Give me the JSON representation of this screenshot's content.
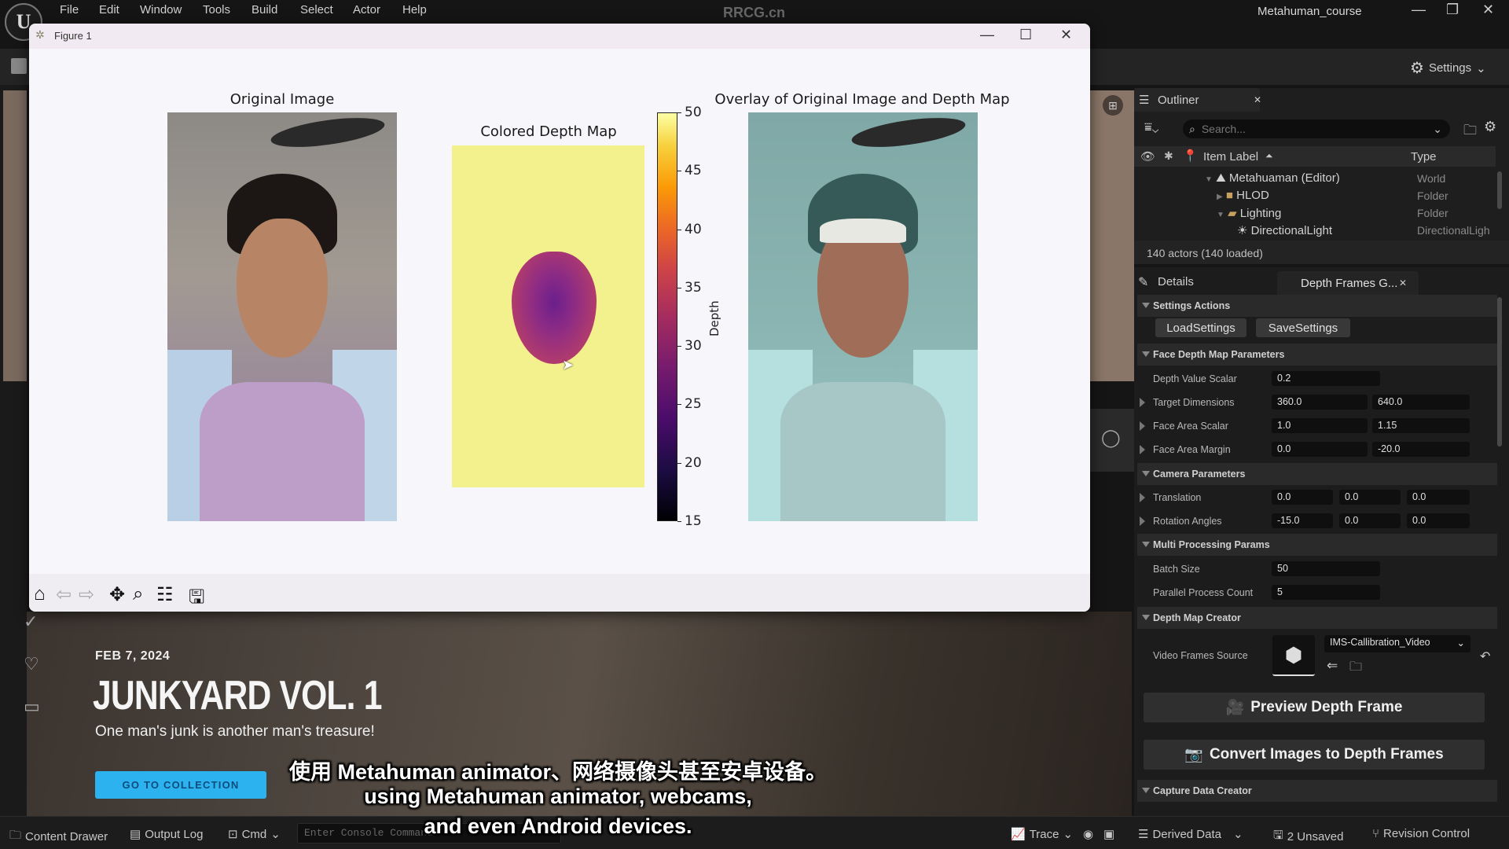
{
  "app": {
    "logo": "U",
    "menu": [
      "File",
      "Edit",
      "Window",
      "Tools",
      "Build",
      "Select",
      "Actor",
      "Help"
    ],
    "watermark": "RRCG.cn",
    "project_title": "Metahuman_course",
    "window_controls": {
      "minimize": "—",
      "restore": "❐",
      "close": "✕"
    },
    "settings_label": "Settings"
  },
  "figure": {
    "title": "Figure 1",
    "controls": {
      "minimize": "—",
      "maximize": "☐",
      "close": "✕"
    },
    "panels": {
      "original_title": "Original Image",
      "depth_title": "Colored Depth Map",
      "overlay_title": "Overlay of Original Image and Depth Map"
    },
    "toolbar": [
      "home-icon",
      "back-icon",
      "forward-icon",
      "pan-icon",
      "zoom-icon",
      "configure-icon",
      "save-icon"
    ]
  },
  "chart_data": {
    "type": "heatmap",
    "title": "Colored Depth Map",
    "colormap": "inferno",
    "colorbar": {
      "label": "Depth",
      "range": [
        15,
        50
      ],
      "ticks": [
        15,
        20,
        25,
        30,
        35,
        40,
        45,
        50
      ]
    },
    "background_value": 50,
    "face_region_value_range": [
      26,
      36
    ]
  },
  "outliner": {
    "tab_label": "Outliner",
    "search_placeholder": "Search...",
    "columns": {
      "label": "Item Label",
      "type": "Type"
    },
    "rows": [
      {
        "label": "Metahuaman (Editor)",
        "type": "World",
        "icon": "world-icon"
      },
      {
        "label": "HLOD",
        "type": "Folder",
        "icon": "folder-icon"
      },
      {
        "label": "Lighting",
        "type": "Folder",
        "icon": "folder-open-icon"
      },
      {
        "label": "DirectionalLight",
        "type": "DirectionalLigh",
        "icon": "light-icon"
      }
    ],
    "actor_count": "140 actors (140 loaded)"
  },
  "details": {
    "tab_label": "Details",
    "tab2_label": "Depth Frames G...",
    "sections": {
      "settings_actions": "Settings Actions",
      "face_depth": "Face Depth Map Parameters",
      "camera": "Camera Parameters",
      "multi": "Multi Processing Params",
      "creator": "Depth Map Creator",
      "capture": "Capture Data Creator"
    },
    "buttons": {
      "load": "LoadSettings",
      "save": "SaveSettings"
    },
    "props": {
      "depth_value_scalar": {
        "label": "Depth Value Scalar",
        "value": "0.2"
      },
      "target_dimensions": {
        "label": "Target Dimensions",
        "x": "360.0",
        "y": "640.0"
      },
      "face_area_scalar": {
        "label": "Face Area Scalar",
        "x": "1.0",
        "y": "1.15"
      },
      "face_area_margin": {
        "label": "Face Area Margin",
        "x": "0.0",
        "y": "-20.0"
      },
      "translation": {
        "label": "Translation",
        "x": "0.0",
        "y": "0.0",
        "z": "0.0"
      },
      "rotation": {
        "label": "Rotation Angles",
        "x": "-15.0",
        "y": "0.0",
        "z": "0.0"
      },
      "batch_size": {
        "label": "Batch Size",
        "value": "50"
      },
      "parallel": {
        "label": "Parallel Process Count",
        "value": "5"
      },
      "video_source": {
        "label": "Video Frames Source",
        "value": "IMS-Callibration_Video"
      }
    },
    "preview_btn": "Preview Depth Frame",
    "convert_btn": "Convert Images to Depth Frames"
  },
  "promo": {
    "date": "FEB 7, 2024",
    "title": "JUNKYARD VOL. 1",
    "subtitle": "One man's junk is another man's treasure!",
    "button": "GO TO COLLECTION"
  },
  "subtitles": {
    "zh": "使用 Metahuman animator、网络摄像头甚至安卓设备。",
    "en1": "using Metahuman animator, webcams,",
    "en2": "and even Android devices."
  },
  "statusbar": {
    "content_drawer": "Content Drawer",
    "output_log": "Output Log",
    "cmd": "Cmd",
    "console_placeholder": "Enter Console Command",
    "trace": "Trace",
    "derived_data": "Derived Data",
    "unsaved": "2 Unsaved",
    "revision": "Revision Control"
  }
}
